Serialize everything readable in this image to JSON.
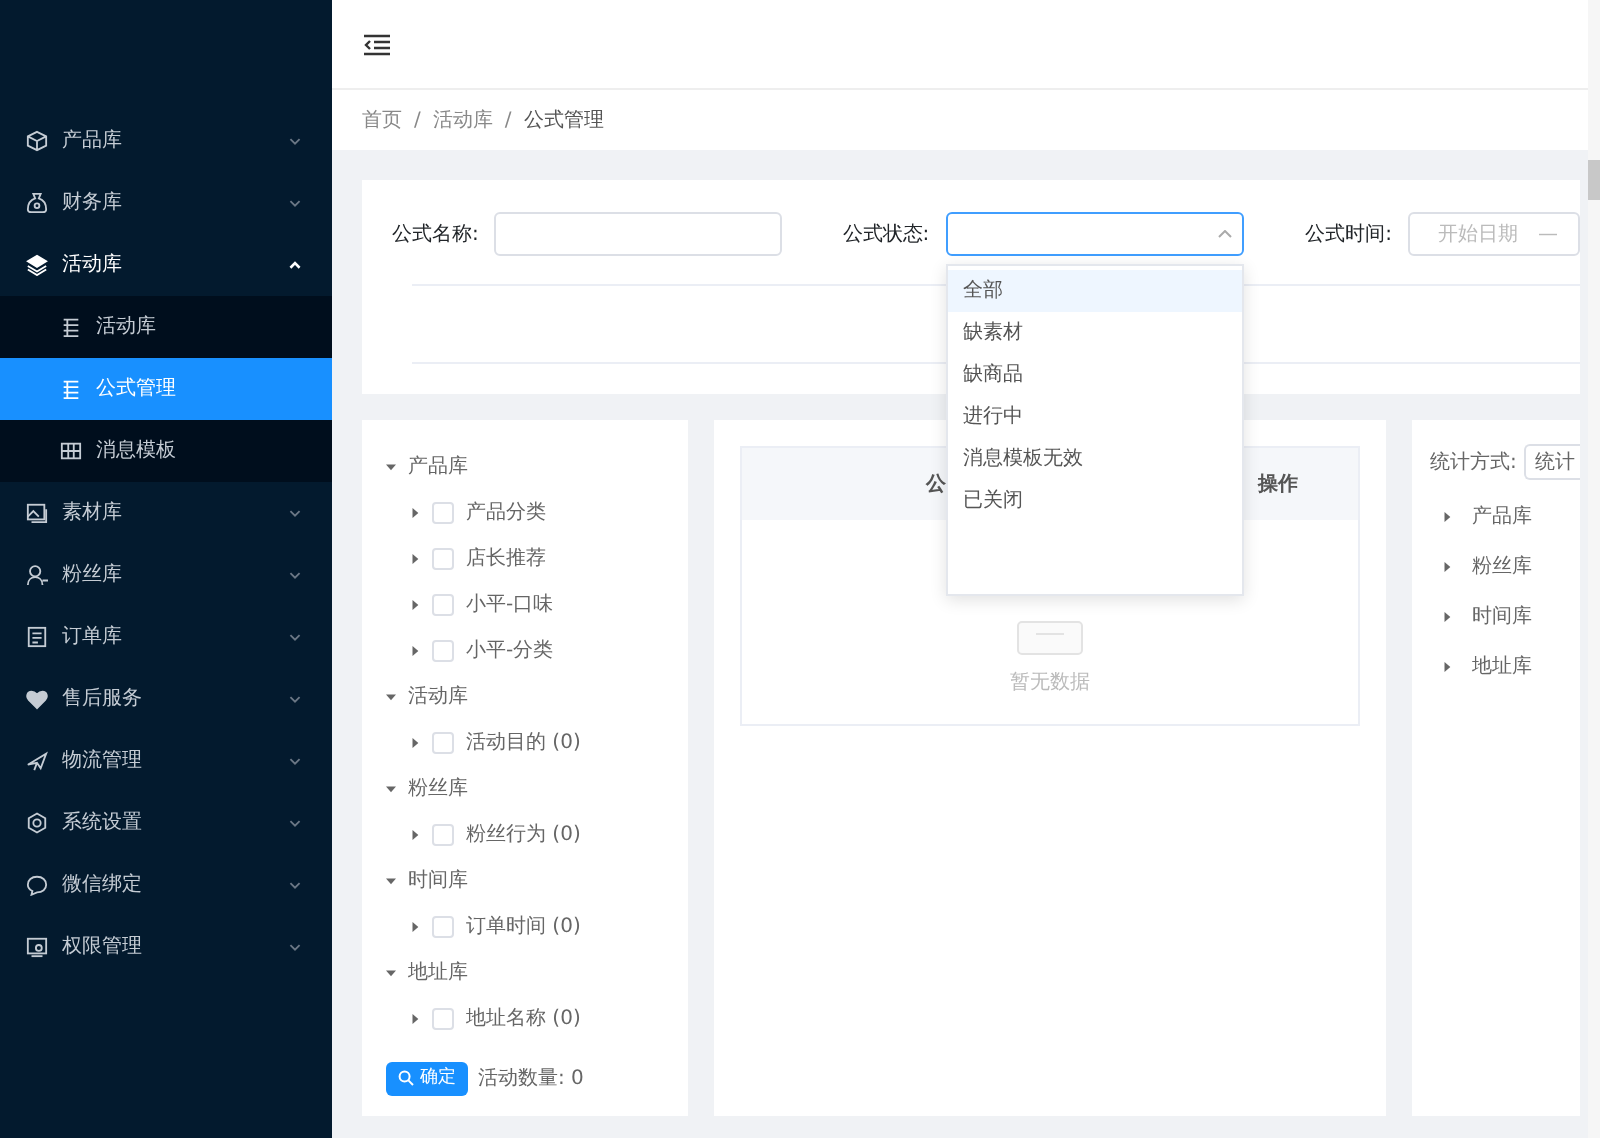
{
  "sidebar": {
    "items": [
      {
        "label": "产品库",
        "expanded": false
      },
      {
        "label": "财务库",
        "expanded": false
      },
      {
        "label": "活动库",
        "expanded": true,
        "children": [
          {
            "label": "活动库",
            "selected": false
          },
          {
            "label": "公式管理",
            "selected": true
          },
          {
            "label": "消息模板",
            "selected": false
          }
        ]
      },
      {
        "label": "素材库",
        "expanded": false
      },
      {
        "label": "粉丝库",
        "expanded": false
      },
      {
        "label": "订单库",
        "expanded": false
      },
      {
        "label": "售后服务",
        "expanded": false
      },
      {
        "label": "物流管理",
        "expanded": false
      },
      {
        "label": "系统设置",
        "expanded": false
      },
      {
        "label": "微信绑定",
        "expanded": false
      },
      {
        "label": "权限管理",
        "expanded": false
      }
    ]
  },
  "breadcrumb": [
    "首页",
    "活动库",
    "公式管理"
  ],
  "breadcrumb_separator": "/",
  "filters": {
    "name_label": "公式名称:",
    "status_label": "公式状态:",
    "time_label": "公式时间:",
    "date_start_placeholder": "开始日期",
    "date_separator": "—"
  },
  "status_dropdown": {
    "open": true,
    "options": [
      {
        "label": "全部",
        "selected": true
      },
      {
        "label": "缺素材",
        "selected": false
      },
      {
        "label": "缺商品",
        "selected": false
      },
      {
        "label": "进行中",
        "selected": false
      },
      {
        "label": "消息模板无效",
        "selected": false
      },
      {
        "label": "已关闭",
        "selected": false
      }
    ]
  },
  "tree": [
    {
      "label": "产品库",
      "expanded": true,
      "children": [
        {
          "label": "产品分类",
          "checked": false
        },
        {
          "label": "店长推荐",
          "checked": false
        },
        {
          "label": "小平-口味",
          "checked": false
        },
        {
          "label": "小平-分类",
          "checked": false
        }
      ]
    },
    {
      "label": "活动库",
      "expanded": true,
      "children": [
        {
          "label": "活动目的 (0)",
          "checked": false
        }
      ]
    },
    {
      "label": "粉丝库",
      "expanded": true,
      "children": [
        {
          "label": "粉丝行为 (0)",
          "checked": false
        }
      ]
    },
    {
      "label": "时间库",
      "expanded": true,
      "children": [
        {
          "label": "订单时间 (0)",
          "checked": false
        }
      ]
    },
    {
      "label": "地址库",
      "expanded": true,
      "children": [
        {
          "label": "地址名称 (0)",
          "checked": false
        }
      ]
    }
  ],
  "confirm_button": "确定",
  "activity_count": "活动数量: 0",
  "table": {
    "columns": [
      "公",
      "操作"
    ],
    "empty_text": "暂无数据"
  },
  "stats": {
    "label": "统计方式:",
    "select_value": "统计",
    "items": [
      {
        "label": "产品库",
        "expanded": false
      },
      {
        "label": "粉丝库",
        "expanded": false
      },
      {
        "label": "时间库",
        "expanded": false
      },
      {
        "label": "地址库",
        "expanded": false
      }
    ]
  }
}
